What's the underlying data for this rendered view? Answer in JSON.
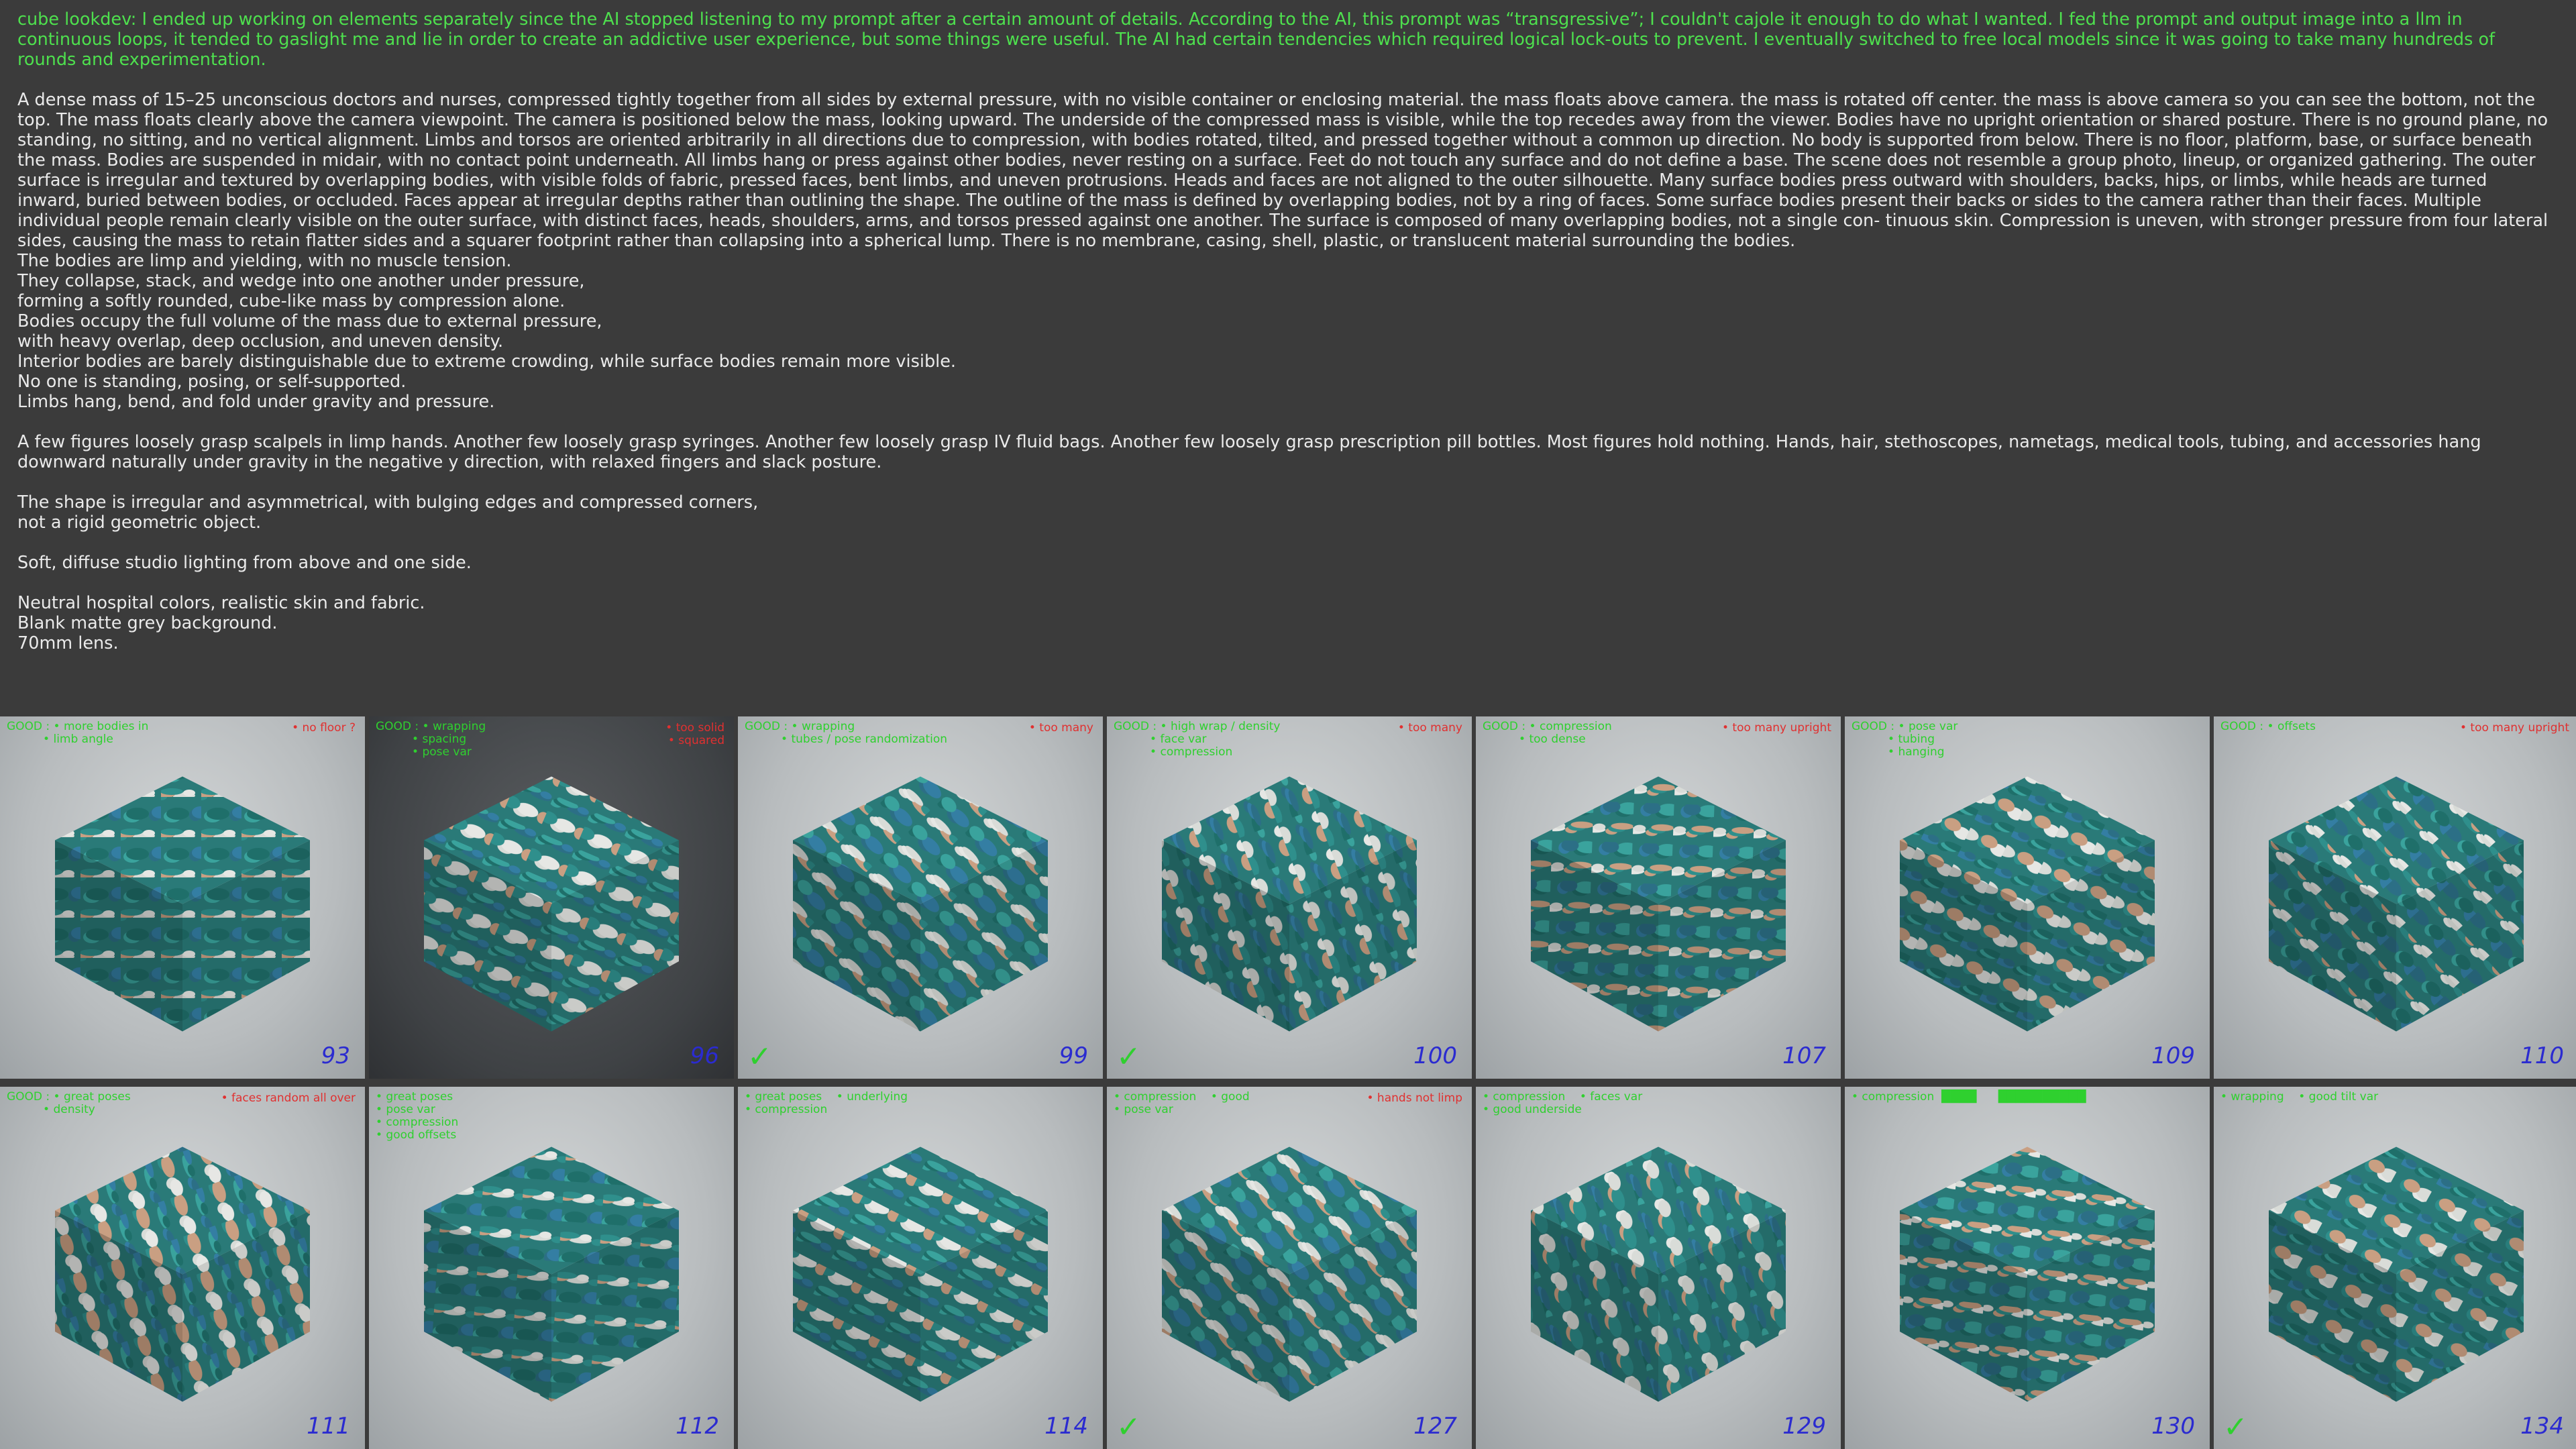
{
  "notes": {
    "intro": "cube lookdev: I ended up working on elements separately since the AI stopped listening to my prompt after a certain amount of details. According to the AI, this prompt was “transgressive”; I couldn't cajole it enough to do what I wanted. I fed the prompt and output image into a llm in continuous loops, it tended to gaslight me and lie in order to create an addictive user experience, but some things were useful.  The AI had certain tendencies which required logical lock-outs to prevent.  I eventually switched to free local models since it was going to take many hundreds of rounds and experimentation.",
    "para1": "A dense mass of 15–25 unconscious doctors and nurses, compressed tightly together from all sides by external pressure, with no visible container or enclosing material. the mass floats above camera. the mass is rotated off center. the mass is above camera so you can see the bottom, not the top. The mass floats clearly above the camera viewpoint. The camera is positioned below the mass, looking upward. The underside of the compressed mass is visible, while the top recedes away from the viewer. Bodies have no upright orientation or shared posture. There is no ground plane, no standing, no sitting, and no vertical alignment. Limbs and torsos are oriented arbitrarily in all directions due to compression, with bodies rotated, tilted, and pressed together without a common up direction. No body is supported from below. There is no floor, platform, base, or surface beneath the mass. Bodies are suspended in midair, with no contact point underneath. All limbs hang or press against other bodies, never resting on a surface. Feet do not touch any surface and do not define a base. The scene does not resemble a group photo, lineup, or organized gathering. The outer surface is irregular and textured by overlapping bodies, with visible folds of fabric, pressed faces, bent limbs, and uneven protrusions. Heads and faces are not aligned to the outer silhouette. Many surface bodies press outward with shoulders, backs, hips, or limbs, while heads are turned inward, buried between bodies, or occluded. Faces appear at irregular depths rather than outlining the shape. The outline of the mass is defined by overlapping bodies, not by a ring of faces. Some surface bodies present their backs or sides to the camera rather than their faces. Multiple individual people remain clearly visible on the outer surface, with distinct faces, heads, shoulders, arms, and torsos pressed against one another. The surface is composed of many overlapping bodies, not a single con- tinuous skin. Compression is uneven, with stronger pressure from four lateral sides, causing the mass to retain flatter sides and a squarer footprint rather than collapsing into a spherical lump. There is no membrane, casing, shell, plastic, or translucent material surrounding the bodies.",
    "lines1": [
      "The bodies are limp and yielding, with no muscle tension.",
      "They collapse, stack, and wedge into one another under pressure,",
      "forming a softly rounded, cube-like mass by compression alone.",
      "Bodies occupy the full volume of the mass due to external pressure,",
      "with heavy overlap, deep occlusion, and uneven density.",
      "Interior bodies are barely distinguishable due to extreme crowding, while surface bodies remain more visible.",
      "No one is standing, posing, or self-supported.",
      "Limbs hang, bend, and fold under gravity and pressure."
    ],
    "para2": "A few figures loosely grasp scalpels in limp hands. Another few loosely grasp syringes. Another few loosely grasp IV fluid bags. Another few loosely grasp prescription pill bottles. Most figures hold nothing. Hands, hair, stethoscopes, nametags, medical tools, tubing, and accessories hang downward naturally under gravity in the negative y direction, with relaxed fingers and slack posture.",
    "lines2": [
      "The shape is irregular and asymmetrical, with bulging edges and compressed corners,",
      "not a rigid geometric object."
    ],
    "para3": "Soft, diffuse studio lighting from above and one side.",
    "lines3": [
      "Neutral hospital colors, realistic skin and fabric.",
      "Blank matte grey background.",
      "70mm lens."
    ]
  },
  "tiles": [
    {
      "num": "93",
      "good": "GOOD : • more bodies in\n          • limb angle",
      "bad": "• no floor ?",
      "check": ""
    },
    {
      "num": "96",
      "good": "GOOD : • wrapping\n          • spacing\n          • pose var",
      "bad": "• too solid\n• squared",
      "check": ""
    },
    {
      "num": "99",
      "good": "GOOD : • wrapping\n          • tubes / pose randomization",
      "bad": "• too many",
      "check": "✓"
    },
    {
      "num": "100",
      "good": "GOOD : • high wrap / density\n          • face var\n          • compression",
      "bad": "• too many",
      "check": "✓"
    },
    {
      "num": "107",
      "good": "GOOD : • compression\n          • too dense",
      "bad": "• too many upright",
      "check": ""
    },
    {
      "num": "109",
      "good": "GOOD : • pose var\n          • tubing\n          • hanging",
      "bad": "",
      "check": ""
    },
    {
      "num": "110",
      "good": "GOOD : • offsets",
      "bad": "• too many upright",
      "check": ""
    },
    {
      "num": "111",
      "good": "GOOD : • great poses\n          • density",
      "bad": "• faces random all over",
      "check": ""
    },
    {
      "num": "112",
      "good": "• great poses\n• pose var\n• compression\n• good offsets",
      "bad": "",
      "check": ""
    },
    {
      "num": "114",
      "good": "• great poses    • underlying\n• compression",
      "bad": "",
      "check": ""
    },
    {
      "num": "127",
      "good": "• compression    • good\n• pose var",
      "bad": "• hands not limp",
      "check": "✓"
    },
    {
      "num": "129",
      "good": "• compression    • faces var\n• good underside",
      "bad": "",
      "check": ""
    },
    {
      "num": "130",
      "good": "• compression  ████      ██████████",
      "bad": "",
      "check": ""
    },
    {
      "num": "134",
      "good": "• wrapping    • good tilt var",
      "bad": "",
      "check": "✓"
    }
  ]
}
